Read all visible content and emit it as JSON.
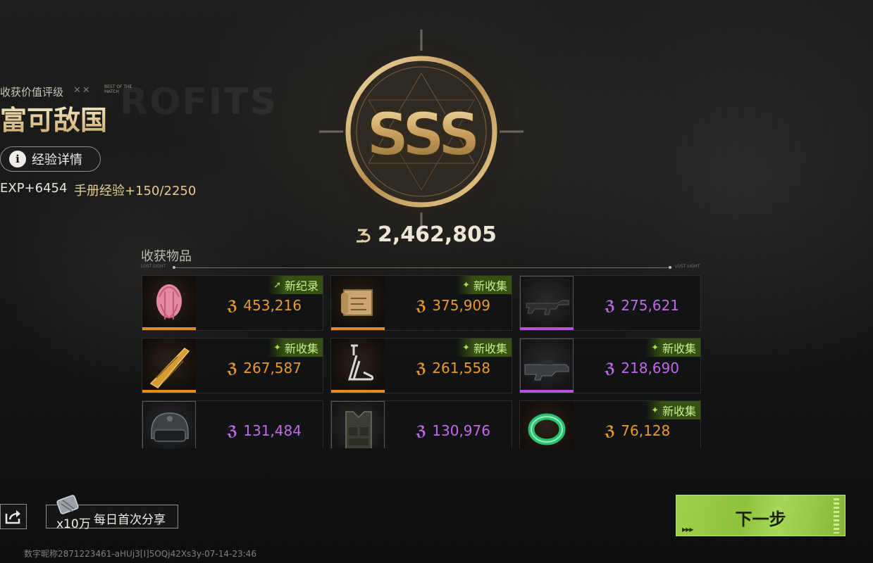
{
  "rating": {
    "label": "收获价值评级",
    "deco": "✕✕",
    "bestof": "BEST OF THE MATCH",
    "title": "富可敌国",
    "grade": "SSS",
    "ghost_text": "ROFITS"
  },
  "exp": {
    "button_label": "经验详情",
    "exp_text": "EXP+6454",
    "manual_text": "手册经验+150/2250"
  },
  "total_value": "2,462,805",
  "loot": {
    "header": "收获物品",
    "tag_left": "LOST LIGHT",
    "tag_right": "LOST LIGHT",
    "items": [
      {
        "name": "pink-hair",
        "value": "453,216",
        "rarity": "orange",
        "badge": "新纪录",
        "badge_icon": "arrow-up-icon"
      },
      {
        "name": "treasure-map",
        "value": "375,909",
        "rarity": "orange",
        "badge": "新收集",
        "badge_icon": "sparkle-icon"
      },
      {
        "name": "assault-rifle",
        "value": "275,621",
        "rarity": "purple",
        "badge": "",
        "badge_icon": ""
      },
      {
        "name": "golden-horn",
        "value": "267,587",
        "rarity": "orange",
        "badge": "新收集",
        "badge_icon": "sparkle-icon"
      },
      {
        "name": "high-heel",
        "value": "261,558",
        "rarity": "orange",
        "badge": "新收集",
        "badge_icon": "sparkle-icon"
      },
      {
        "name": "bullpup-rifle",
        "value": "218,690",
        "rarity": "purple",
        "badge": "新收集",
        "badge_icon": "sparkle-icon"
      },
      {
        "name": "helmet",
        "value": "131,484",
        "rarity": "purple",
        "badge": "",
        "badge_icon": ""
      },
      {
        "name": "tactical-vest",
        "value": "130,976",
        "rarity": "purple",
        "badge": "",
        "badge_icon": ""
      },
      {
        "name": "jade-bracelet",
        "value": "76,128",
        "rarity": "orange",
        "badge": "新收集",
        "badge_icon": "sparkle-icon"
      }
    ]
  },
  "share": {
    "reward_count": "x10万",
    "label": "每日首次分享"
  },
  "next_button": "下一步",
  "watermark": "数字昵称2871223461-aHUj3[I]5OQj42Xs3y-07-14-23:46",
  "colors": {
    "orange": "#e89a2c",
    "purple": "#c06ae6",
    "orange_bar": "#e58a1e",
    "purple_bar": "#b552e0",
    "badge_green": "#c8ee8a",
    "next_green": "#9fd04a"
  }
}
